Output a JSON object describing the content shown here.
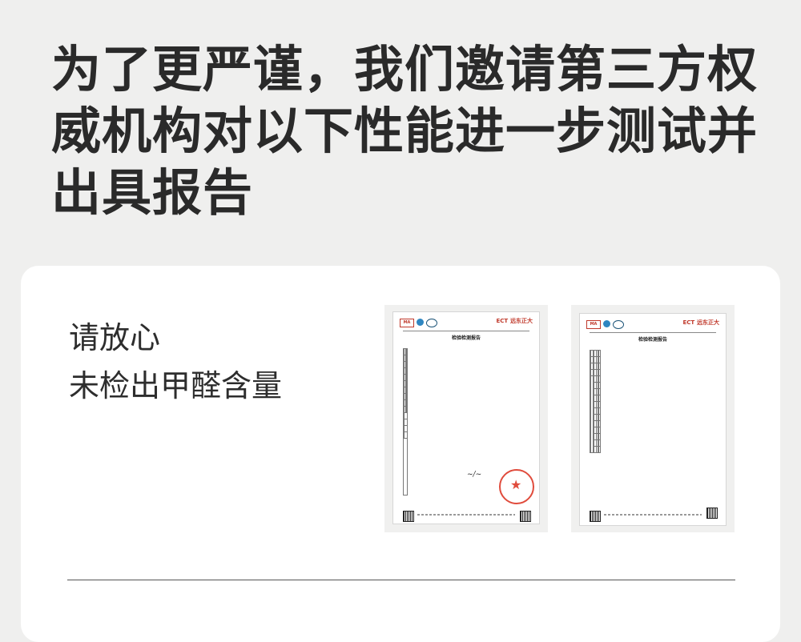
{
  "headline": {
    "line1": "为了更严谨，我们邀请第三方权",
    "line2": "威机构对以下性能进一步测试并",
    "line3": "出具报告"
  },
  "card": {
    "tagline_line1": "请放心",
    "tagline_line2": "未检出甲醛含量"
  },
  "reports": [
    {
      "title": "检验检测报告",
      "brand": "ECT",
      "brand_cn": "远东正大"
    },
    {
      "title": "检验检测报告",
      "brand": "ECT",
      "brand_cn": "远东正大"
    }
  ],
  "colors": {
    "background": "#efefee",
    "card": "#ffffff",
    "headline": "#2a2a2a",
    "brand_blue": "#1a5fb4",
    "stamp_red": "#e04b3c"
  }
}
